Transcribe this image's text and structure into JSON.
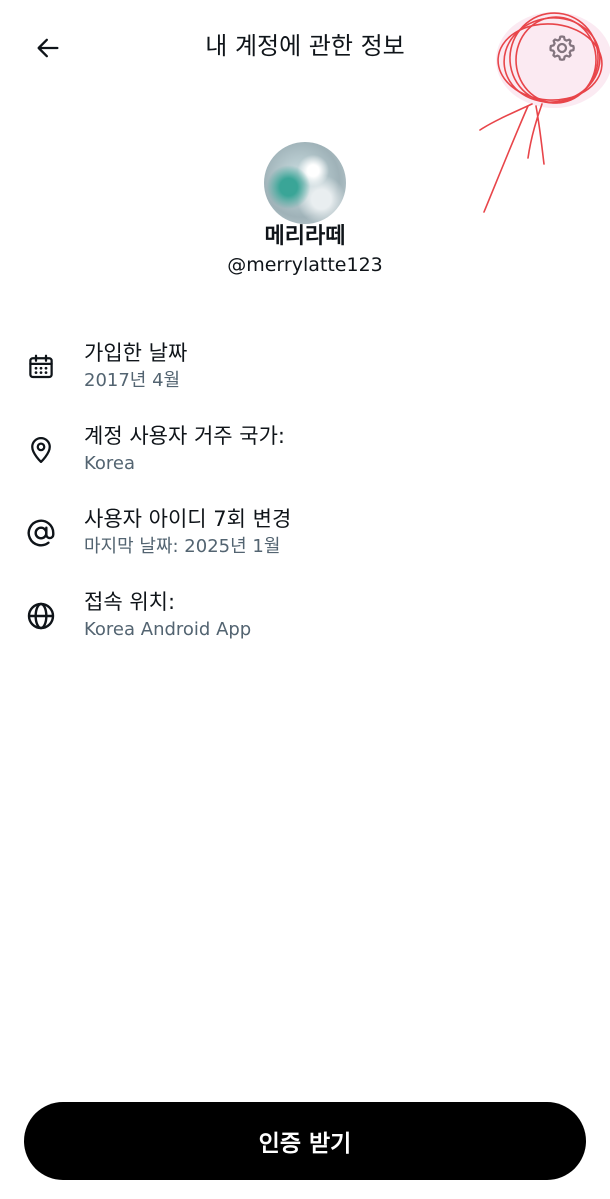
{
  "header": {
    "title": "내 계정에 관한 정보",
    "back_icon": "arrow-left-icon",
    "settings_icon": "gear-icon"
  },
  "profile": {
    "display_name": "메리라떼",
    "handle": "@merrylatte123"
  },
  "info": {
    "items": [
      {
        "icon": "calendar-icon",
        "label": "가입한 날짜",
        "value": "2017년 4월"
      },
      {
        "icon": "location-pin-icon",
        "label": "계정 사용자 거주 국가:",
        "value": "Korea"
      },
      {
        "icon": "at-sign-icon",
        "label": "사용자 아이디 7회 변경",
        "value": "마지막 날짜: 2025년 1월"
      },
      {
        "icon": "globe-icon",
        "label": "접속 위치:",
        "value": "Korea Android App"
      }
    ]
  },
  "footer": {
    "verify_label": "인증 받기"
  },
  "colors": {
    "text_primary": "#0f1419",
    "text_secondary": "#536471",
    "button_bg": "#000000",
    "annotation_red": "#e8454a"
  }
}
